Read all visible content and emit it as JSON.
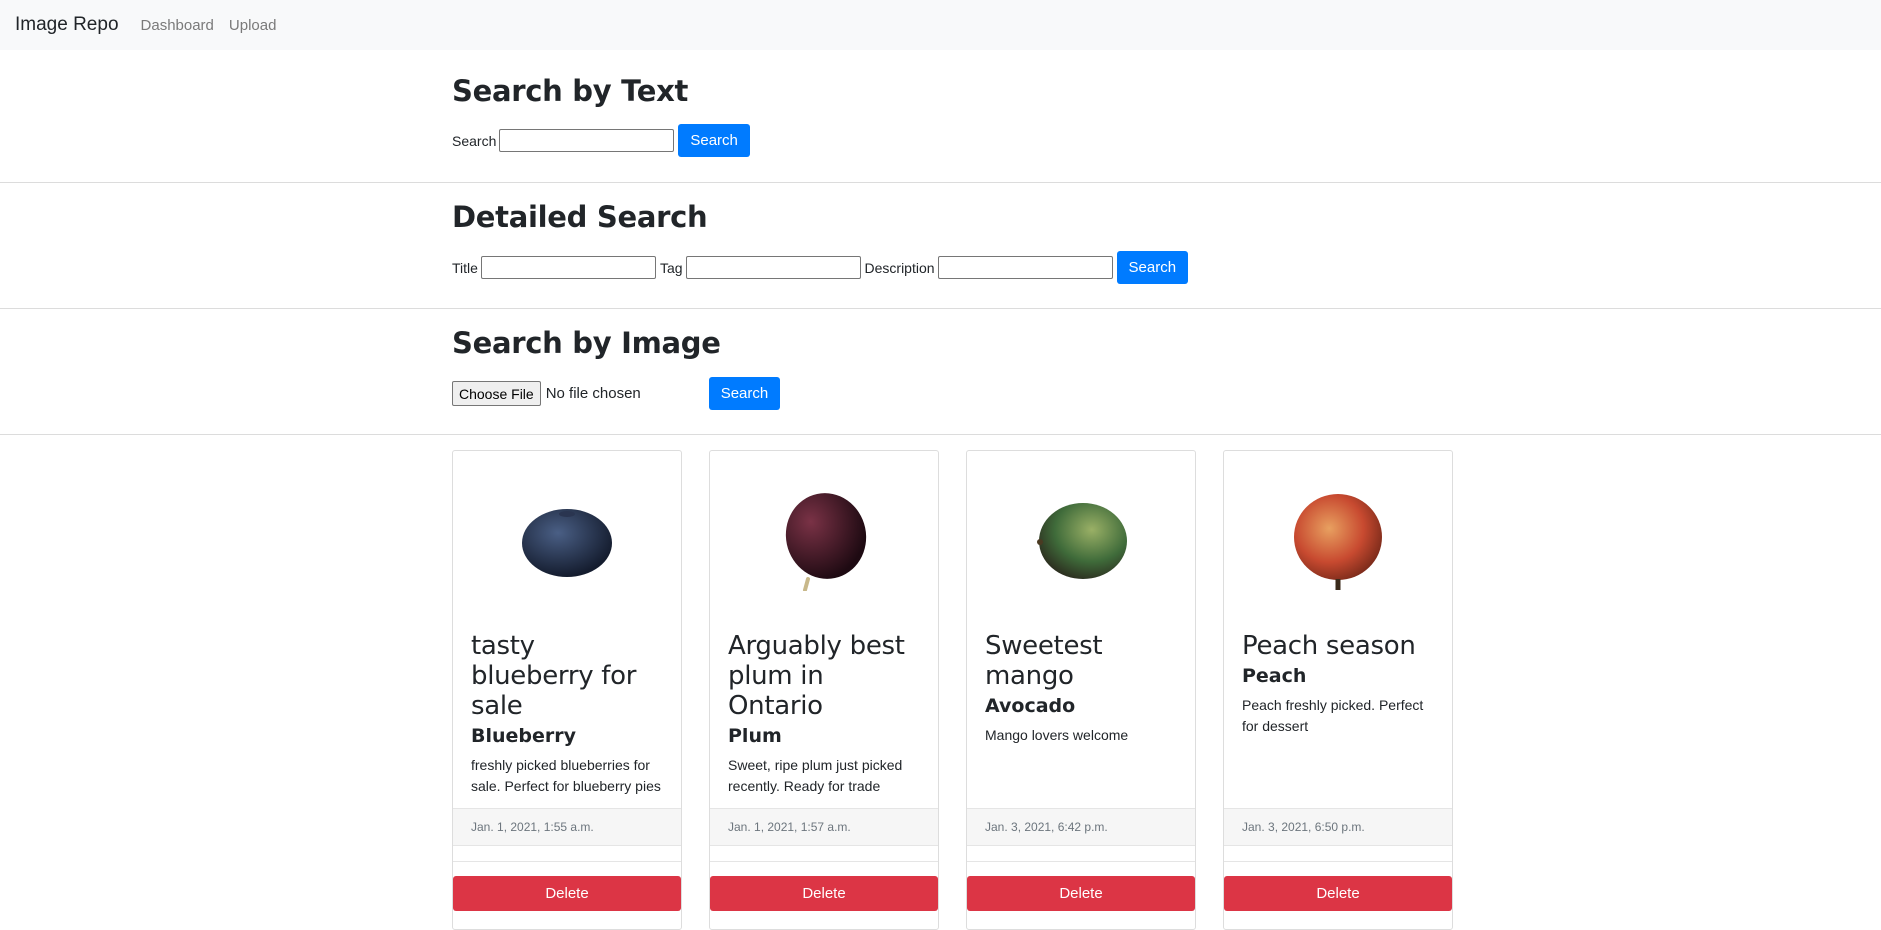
{
  "navbar": {
    "brand": "Image Repo",
    "links": [
      "Dashboard",
      "Upload"
    ]
  },
  "text_search": {
    "heading": "Search by Text",
    "label": "Search",
    "value": "",
    "button": "Search"
  },
  "detailed_search": {
    "heading": "Detailed Search",
    "title_label": "Title",
    "tag_label": "Tag",
    "description_label": "Description",
    "button": "Search"
  },
  "image_search": {
    "heading": "Search by Image",
    "choose_button": "Choose File",
    "file_status": "No file chosen",
    "button": "Search"
  },
  "cards": [
    {
      "title": "tasty blueberry for sale",
      "tag": "Blueberry",
      "description": "freshly picked blueberries for sale. Perfect for blueberry pies",
      "date": "Jan. 1, 2021, 1:55 a.m.",
      "delete": "Delete",
      "image_icon": "blueberry-image"
    },
    {
      "title": "Arguably best plum in Ontario",
      "tag": "Plum",
      "description": "Sweet, ripe plum just picked recently. Ready for trade",
      "date": "Jan. 1, 2021, 1:57 a.m.",
      "delete": "Delete",
      "image_icon": "plum-image"
    },
    {
      "title": "Sweetest mango",
      "tag": "Avocado",
      "description": "Mango lovers welcome",
      "date": "Jan. 3, 2021, 6:42 p.m.",
      "delete": "Delete",
      "image_icon": "mango-image"
    },
    {
      "title": "Peach season",
      "tag": "Peach",
      "description": "Peach freshly picked. Perfect for dessert",
      "date": "Jan. 3, 2021, 6:50 p.m.",
      "delete": "Delete",
      "image_icon": "peach-image"
    }
  ],
  "colors": {
    "primary": "#007bff",
    "danger": "#dc3545",
    "navbar_bg": "#f8f9fa"
  }
}
